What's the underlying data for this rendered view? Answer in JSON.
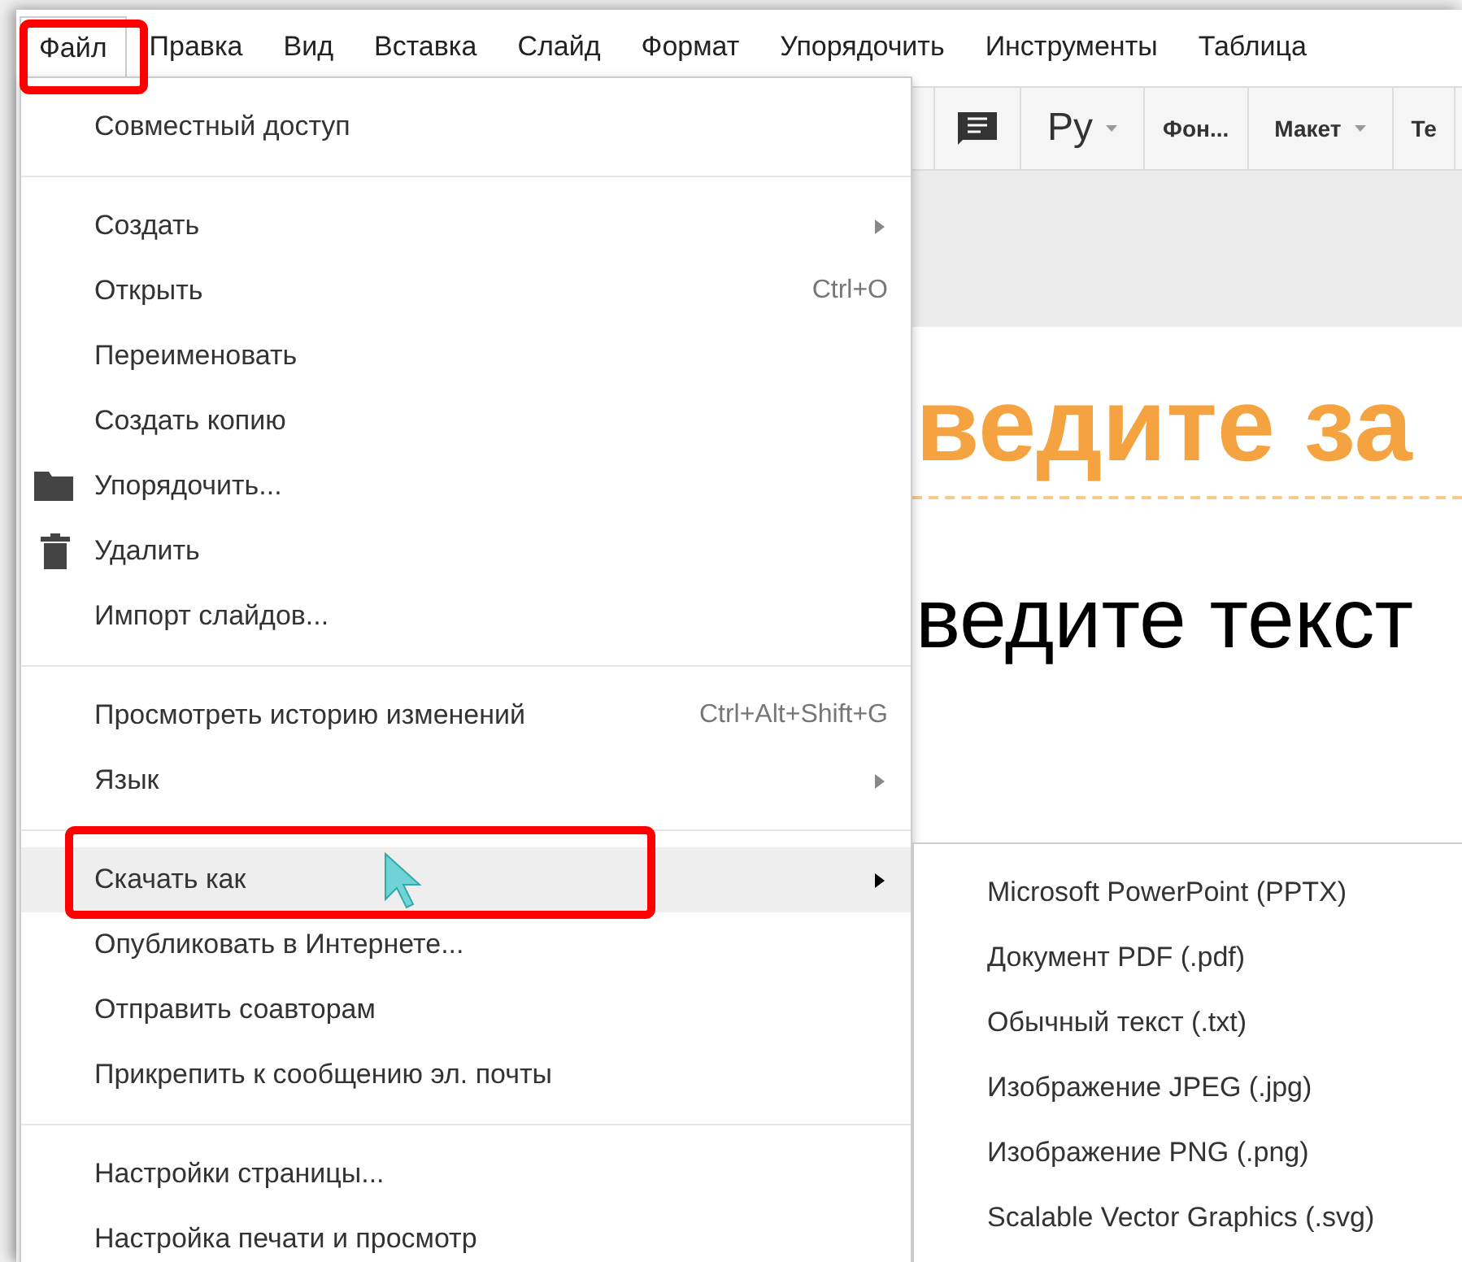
{
  "menu_bar": [
    {
      "label": "Файл",
      "selected": true
    },
    {
      "label": "Правка",
      "selected": false
    },
    {
      "label": "Вид",
      "selected": false
    },
    {
      "label": "Вставка",
      "selected": false
    },
    {
      "label": "Слайд",
      "selected": false
    },
    {
      "label": "Формат",
      "selected": false
    },
    {
      "label": "Упорядочить",
      "selected": false
    },
    {
      "label": "Инструменты",
      "selected": false
    },
    {
      "label": "Таблица",
      "selected": false
    }
  ],
  "toolbar": [
    {
      "kind": "blank"
    },
    {
      "kind": "comment"
    },
    {
      "kind": "dropdown",
      "label": "Ру"
    },
    {
      "kind": "button",
      "label": "Фон..."
    },
    {
      "kind": "dropdown",
      "label": "Макет"
    },
    {
      "kind": "button",
      "label": "Те"
    }
  ],
  "slide": {
    "title": "ведите за",
    "body": "ведите текст"
  },
  "file_menu": {
    "sections": [
      [
        {
          "kind": "plain",
          "label": "Совместный доступ",
          "selected": false
        }
      ],
      [
        {
          "kind": "submenu",
          "label": "Создать",
          "selected": false
        },
        {
          "kind": "plain",
          "label": "Открыть",
          "shortcut": "Ctrl+O",
          "selected": false
        },
        {
          "kind": "plain",
          "label": "Переименовать",
          "selected": false
        },
        {
          "kind": "plain",
          "label": "Создать копию",
          "selected": false
        },
        {
          "kind": "folder",
          "label": "Упорядочить...",
          "selected": false
        },
        {
          "kind": "trash",
          "label": "Удалить",
          "selected": false
        },
        {
          "kind": "plain",
          "label": "Импорт слайдов...",
          "selected": false
        }
      ],
      [
        {
          "kind": "plain",
          "label": "Просмотреть историю изменений",
          "shortcut": "Ctrl+Alt+Shift+G",
          "selected": false
        },
        {
          "kind": "submenu",
          "label": "Язык",
          "selected": false
        }
      ],
      [
        {
          "kind": "submenu",
          "label": "Скачать как",
          "selected": true
        },
        {
          "kind": "plain",
          "label": "Опубликовать в Интернете...",
          "selected": false
        },
        {
          "kind": "plain",
          "label": "Отправить соавторам",
          "selected": false
        },
        {
          "kind": "plain",
          "label": "Прикрепить к сообщению эл. почты",
          "selected": false
        }
      ],
      [
        {
          "kind": "plain",
          "label": "Настройки страницы...",
          "selected": false
        },
        {
          "kind": "plain",
          "label": "Настройка печати и просмотр",
          "selected": false
        }
      ]
    ]
  },
  "download_submenu": [
    "Microsoft PowerPoint (PPTX)",
    "Документ PDF (.pdf)",
    "Обычный текст (.txt)",
    "Изображение JPEG (.jpg)",
    "Изображение PNG (.png)",
    "Scalable Vector Graphics (.svg)"
  ]
}
